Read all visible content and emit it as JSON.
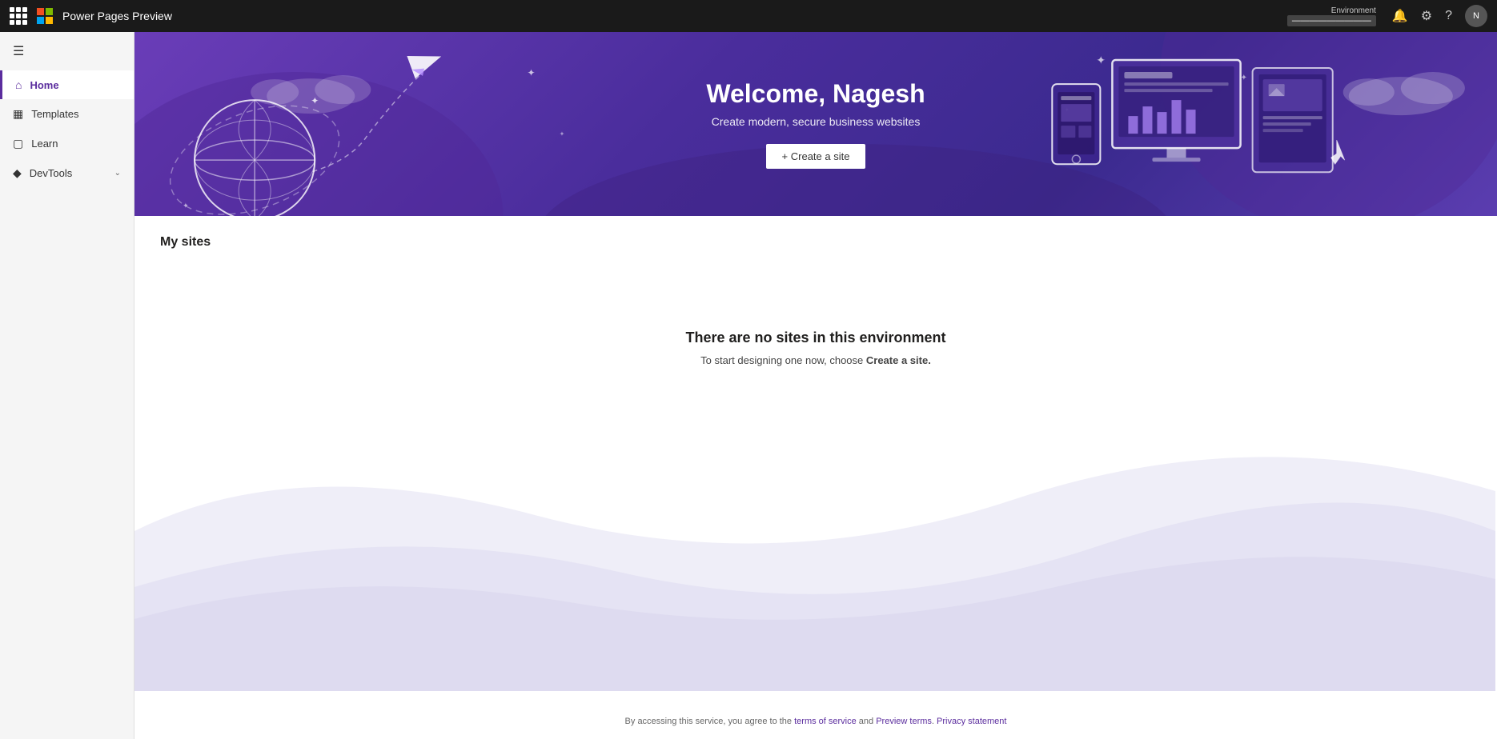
{
  "topbar": {
    "app_title": "Power Pages Preview",
    "env_label": "Environment",
    "env_name": "—————————",
    "icons": {
      "notification": "🔔",
      "settings": "⚙",
      "help": "?"
    }
  },
  "sidebar": {
    "items": [
      {
        "id": "home",
        "label": "Home",
        "icon": "⊞",
        "active": true
      },
      {
        "id": "templates",
        "label": "Templates",
        "icon": "⊡",
        "active": false
      },
      {
        "id": "learn",
        "label": "Learn",
        "icon": "□",
        "active": false
      },
      {
        "id": "devtools",
        "label": "DevTools",
        "icon": "◈",
        "active": false,
        "has_chevron": true
      }
    ]
  },
  "hero": {
    "title": "Welcome, Nagesh",
    "subtitle": "Create modern, secure business websites",
    "cta_label": "+ Create a site"
  },
  "my_sites": {
    "section_title": "My sites",
    "empty_title": "There are no sites in this environment",
    "empty_sub_prefix": "To start designing one now, choose ",
    "empty_sub_link": "Create a site.",
    "empty_sub_suffix": ""
  },
  "footer": {
    "prefix": "By accessing this service, you agree to the ",
    "terms_label": "terms of service",
    "and": " and ",
    "preview_label": "Preview terms",
    "separator": ". ",
    "privacy_label": "Privacy statement"
  }
}
